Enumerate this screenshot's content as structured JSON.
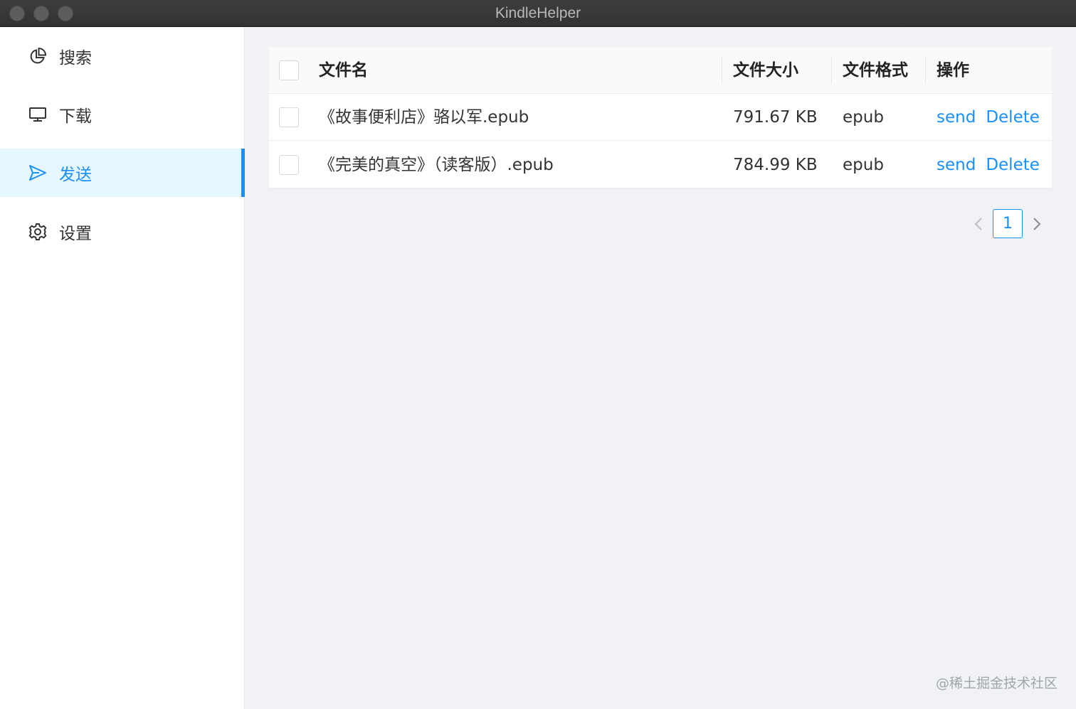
{
  "window": {
    "title": "KindleHelper"
  },
  "sidebar": {
    "items": [
      {
        "label": "搜索",
        "icon": "pie-chart-icon",
        "active": false
      },
      {
        "label": "下载",
        "icon": "monitor-icon",
        "active": false
      },
      {
        "label": "发送",
        "icon": "send-icon",
        "active": true
      },
      {
        "label": "设置",
        "icon": "gear-icon",
        "active": false
      }
    ]
  },
  "table": {
    "columns": {
      "name": "文件名",
      "size": "文件大小",
      "format": "文件格式",
      "action": "操作"
    },
    "rows": [
      {
        "name": "《故事便利店》骆以军.epub",
        "size": "791.67 KB",
        "format": "epub",
        "send": "send",
        "delete": "Delete"
      },
      {
        "name": "《完美的真空》（读客版）.epub",
        "size": "784.99 KB",
        "format": "epub",
        "send": "send",
        "delete": "Delete"
      }
    ]
  },
  "pagination": {
    "prev": "<",
    "current": "1",
    "next": ">"
  },
  "watermark": "@稀土掘金技术社区",
  "colors": {
    "accent": "#1890ff",
    "active_bg": "#e6f7ff",
    "content_bg": "#f0f2f5"
  }
}
